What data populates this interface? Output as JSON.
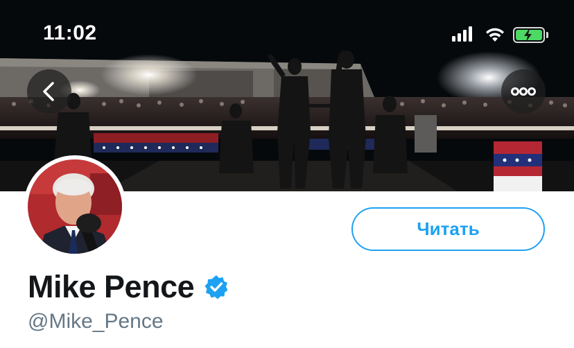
{
  "status_bar": {
    "time": "11:02",
    "signal_icon": "cellular-signal-icon",
    "wifi_icon": "wifi-icon",
    "battery_icon": "battery-charging-icon",
    "battery_level": 0.9
  },
  "header": {
    "back_icon": "chevron-left-icon",
    "more_icon": "more-horizontal-icon"
  },
  "profile": {
    "display_name": "Mike Pence",
    "handle": "@Mike_Pence",
    "verified": true,
    "verified_icon": "verified-badge-icon",
    "follow_label": "Читать"
  },
  "colors": {
    "accent": "#1da1f2",
    "name_text": "#14171a",
    "handle_text": "#657786",
    "battery_green": "#4cd964"
  }
}
